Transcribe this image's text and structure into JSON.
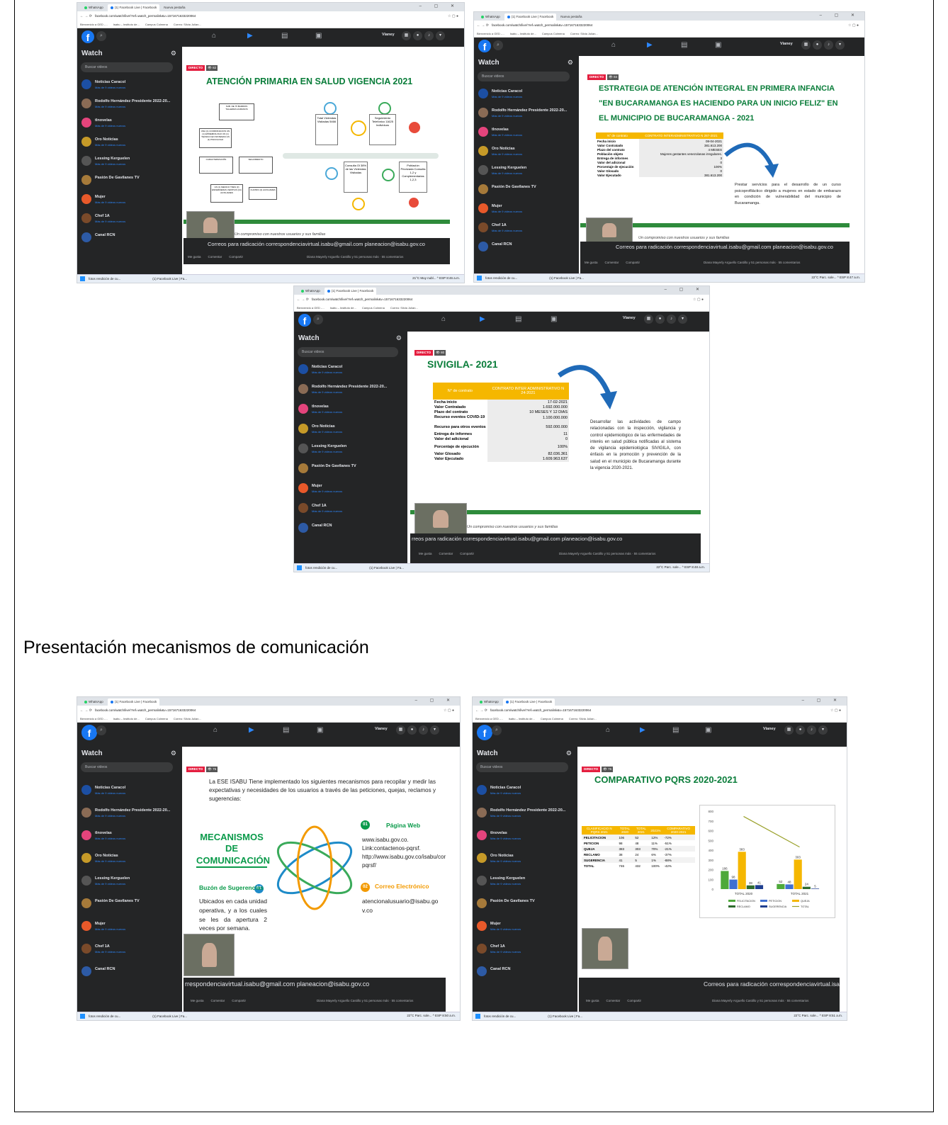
{
  "browser": {
    "tabs": [
      "WhatsApp",
      "(1) Facebook Live | Facebook",
      "Nueva pestaña"
    ],
    "url": "facebook.com/watch/live/?ref=watch_permalink&v=1571671633220064",
    "bookmarks": [
      "Bienvenido a GED -...",
      "Isabu – Instituto de...",
      "Campus Colmena",
      "Correo: Silvia Julian..."
    ]
  },
  "facebook": {
    "user": "Vianey",
    "watch_title": "Watch",
    "search_placeholder": "Buscar videos",
    "sidebar_items": [
      {
        "name": "Noticias Caracol",
        "sub": "Más de 9 videos nuevos",
        "color": "#1c4fa3"
      },
      {
        "name": "Rodolfo Hernández Presidente 2022-20...",
        "sub": "Más de 9 videos nuevos",
        "color": "#8a6b55"
      },
      {
        "name": "tlnovelas",
        "sub": "Más de 9 videos nuevos",
        "color": "#e4447c"
      },
      {
        "name": "Oro Noticias",
        "sub": "Más de 9 videos nuevos",
        "color": "#c69a28"
      },
      {
        "name": "Lessing Kerguelen",
        "sub": "Más de 9 videos nuevos",
        "color": "#555555"
      },
      {
        "name": "Pasión De Gavilanes TV",
        "sub": "",
        "color": "#a67a3a"
      },
      {
        "name": "Mujer",
        "sub": "Más de 9 videos nuevos",
        "color": "#e8592a"
      },
      {
        "name": "Chef 1A",
        "sub": "Más de 9 videos nuevos",
        "color": "#7a4a2a"
      },
      {
        "name": "Canal RCN",
        "sub": "",
        "color": "#2d5aa5"
      }
    ],
    "live_label": "DIRECTO",
    "like": "Me gusta",
    "comment": "Comentar",
    "share": "Compartir",
    "reactions_text": "Diana Mayerly Arguello Castillo y 51 personas más · 55 comentarios",
    "caption": "Correos para radicación correspondenciavirtual.isabu@gmail.com planeacion@isabu.gov.co",
    "caption_partial": "rreos para radicación correspondenciavirtual.isabu@gmail.com planeacion@isabu.gov.co",
    "caption_partial2": "rrespondenciavirtual.isabu@gmail.com planeacion@isabu.gov.co",
    "caption_partial3": "Correos para radicación correspondenciavirtual.isab",
    "slogan": "Un compromiso con nuestros usuarios y sus familias",
    "presenter_tag": "Sr. German Jimenez"
  },
  "taskbar": {
    "app1": "fotos rendición de cu...",
    "app2": "(1) Facebook Live | Fa...",
    "weather1": "21°C Muy nubl...",
    "weather2": "22°C Parc. sole...",
    "lang": "ESP",
    "times": [
      "8:46 a.m.",
      "8:47 a.m.",
      "8:48 a.m.",
      "8:50 a.m.",
      "8:51 a.m."
    ]
  },
  "shots": {
    "s1": {
      "viewers": "82",
      "title": "ATENCIÓN PRIMARIA EN SALUD VIGENCIA 2021",
      "stat1": "Total Viviendas Visitadas 5466",
      "stat2": "Seguimiento Telefónico 11625 Individuos",
      "stat3": "Consulta Ol 38% de las Viviendas Visitadas",
      "stat4": "Población Priorizada Consulta 1,2 y Complementarias 1,2,3"
    },
    "s2": {
      "viewers": "84",
      "title": "ESTRATEGIA DE ATENCIÓN INTEGRAL EN PRIMERA INFANCIA \"EN BUCARAMANGA ES HACIENDO PARA UN INICIO FELIZ\" EN EL MUNICIPIO DE BUCARAMANGA - 2021",
      "col1": "N° de contrato",
      "col2": "CONTRATO INTERADMINISTRATIVO N 287-2021",
      "rows": [
        [
          "Fecha inicio",
          "08-04-2021"
        ],
        [
          "Valor Contratado",
          "381.613.200"
        ],
        [
          "Plazo del contrato",
          "4 MESES"
        ],
        [
          "Población objeto",
          "Mujeres gestantes venezolanas irregulares."
        ],
        [
          "Entrega de informes",
          "3"
        ],
        [
          "Valor del adicional",
          "0"
        ],
        [
          "Porcentaje de ejecución",
          "100%"
        ],
        [
          "Valor Glosado",
          "0"
        ],
        [
          "Valor Ejecutado",
          "381.613.200"
        ]
      ],
      "description": "Prestar servicios para el desarrollo de un curso psicoprofiláctico dirigido a mujeres en estado de embarazo en condición de vulnerabilidad del municipio de Bucaramanga."
    },
    "s3": {
      "viewers": "80",
      "title": "SIVIGILA- 2021",
      "col1": "N° de contrato",
      "col2": "CONTRATO INTER ADMINISTRATIVO N 24-2021",
      "rows": [
        [
          "Fecha inicio",
          "17-02-2021"
        ],
        [
          "Valor Contratado",
          "1.692.000.000"
        ],
        [
          "Plazo del contrato",
          "10 MESES Y 12 DIAS"
        ],
        [
          "Recurso eventos COVID-19",
          "1.100.000.000"
        ],
        [
          "Recurso para otros eventos",
          "592.000.000"
        ],
        [
          "Entrega de informes",
          "11"
        ],
        [
          "Valor del adicional",
          "0"
        ],
        [
          "Porcentaje de ejecución",
          "100%"
        ],
        [
          "Valor Glosado",
          "82.036.361"
        ],
        [
          "Valor Ejecutado",
          "1.609.963.637"
        ]
      ],
      "description": "Desarrollar las actividades de campo relacionadas con la inspección, vigilancia y control epidemiológico de las enfermedades de interés en salud pública notificadas al sistema de vigilancia epidemiológica SIVIGILA, con énfasis en la promoción y prevención de la salud en el municipio de Bucaramanga durante la vigencia 2020-2021."
    },
    "s4": {
      "viewers": "75",
      "intro": "La ESE ISABU Tiene implementado los siguientes mecanismos para recopilar y medir las expectativas y necesidades de los usuarios a través de las peticiones, quejas, reclamos y sugerencias:",
      "heading": "MECANISMOS DE COMUNICACIÓN",
      "web_title": "Página Web",
      "web_text": "www.isabu.gov.co. Link:contactenos-pqrsf. http://www.isabu.gov.co/isabu/contactenos-pqrsf/",
      "box_title": "Buzón de Sugerencias",
      "box_text": "Ubicados en cada unidad operativa, y a los cuales se les da apertura 2 veces por semana.",
      "mail_title": "Correo Electrónico",
      "mail_text": "atencionalusuario@isabu.gov.co",
      "n1": "01",
      "n2": "02",
      "n3": "03"
    },
    "s5": {
      "viewers": "76",
      "title": "COMPARATIVO PQRS 2020-2021",
      "headers": [
        "CLASIFICACIO N PQRS 2021",
        "TOTAL 2020",
        "TOTAL 2021",
        "2021%",
        "COMPARATIVO 2020-2021"
      ],
      "rows": [
        [
          "FELICITACION",
          "106",
          "52",
          "12%",
          "-72%"
        ],
        [
          "PETICION",
          "98",
          "48",
          "11%",
          "-51%"
        ],
        [
          "QUEJA",
          "383",
          "303",
          "70%",
          "-21%"
        ],
        [
          "RECLAMO",
          "38",
          "24",
          "6%",
          "-37%"
        ],
        [
          "SUGERENCIA",
          "41",
          "5",
          "1%",
          "-88%"
        ],
        [
          "TOTAL",
          "746",
          "432",
          "100%",
          "-42%"
        ]
      ]
    }
  },
  "chart_data": {
    "type": "bar",
    "categories": [
      "TOTAL 2020",
      "TOTAL 2021"
    ],
    "series": [
      {
        "name": "FELICITACION",
        "values": [
          186,
          52
        ],
        "color": "#4ea93a"
      },
      {
        "name": "PETICION",
        "values": [
          98,
          48
        ],
        "color": "#3f6fd1"
      },
      {
        "name": "QUEJA",
        "values": [
          383,
          303
        ],
        "color": "#f5b700"
      },
      {
        "name": "RECLAMO",
        "values": [
          38,
          24
        ],
        "color": "#2e6b2e"
      },
      {
        "name": "SUGERENCIA",
        "values": [
          41,
          5
        ],
        "color": "#1f3f8f"
      }
    ],
    "total_line": {
      "name": "TOTAL",
      "values": [
        746,
        432
      ],
      "color": "#9aa12a"
    },
    "ylim": [
      0,
      800
    ],
    "yticks": [
      0,
      100,
      200,
      300,
      400,
      500,
      600,
      700,
      800
    ],
    "legend": "bottom"
  },
  "section": {
    "heading": "Presentación mecanismos de comunicación"
  }
}
